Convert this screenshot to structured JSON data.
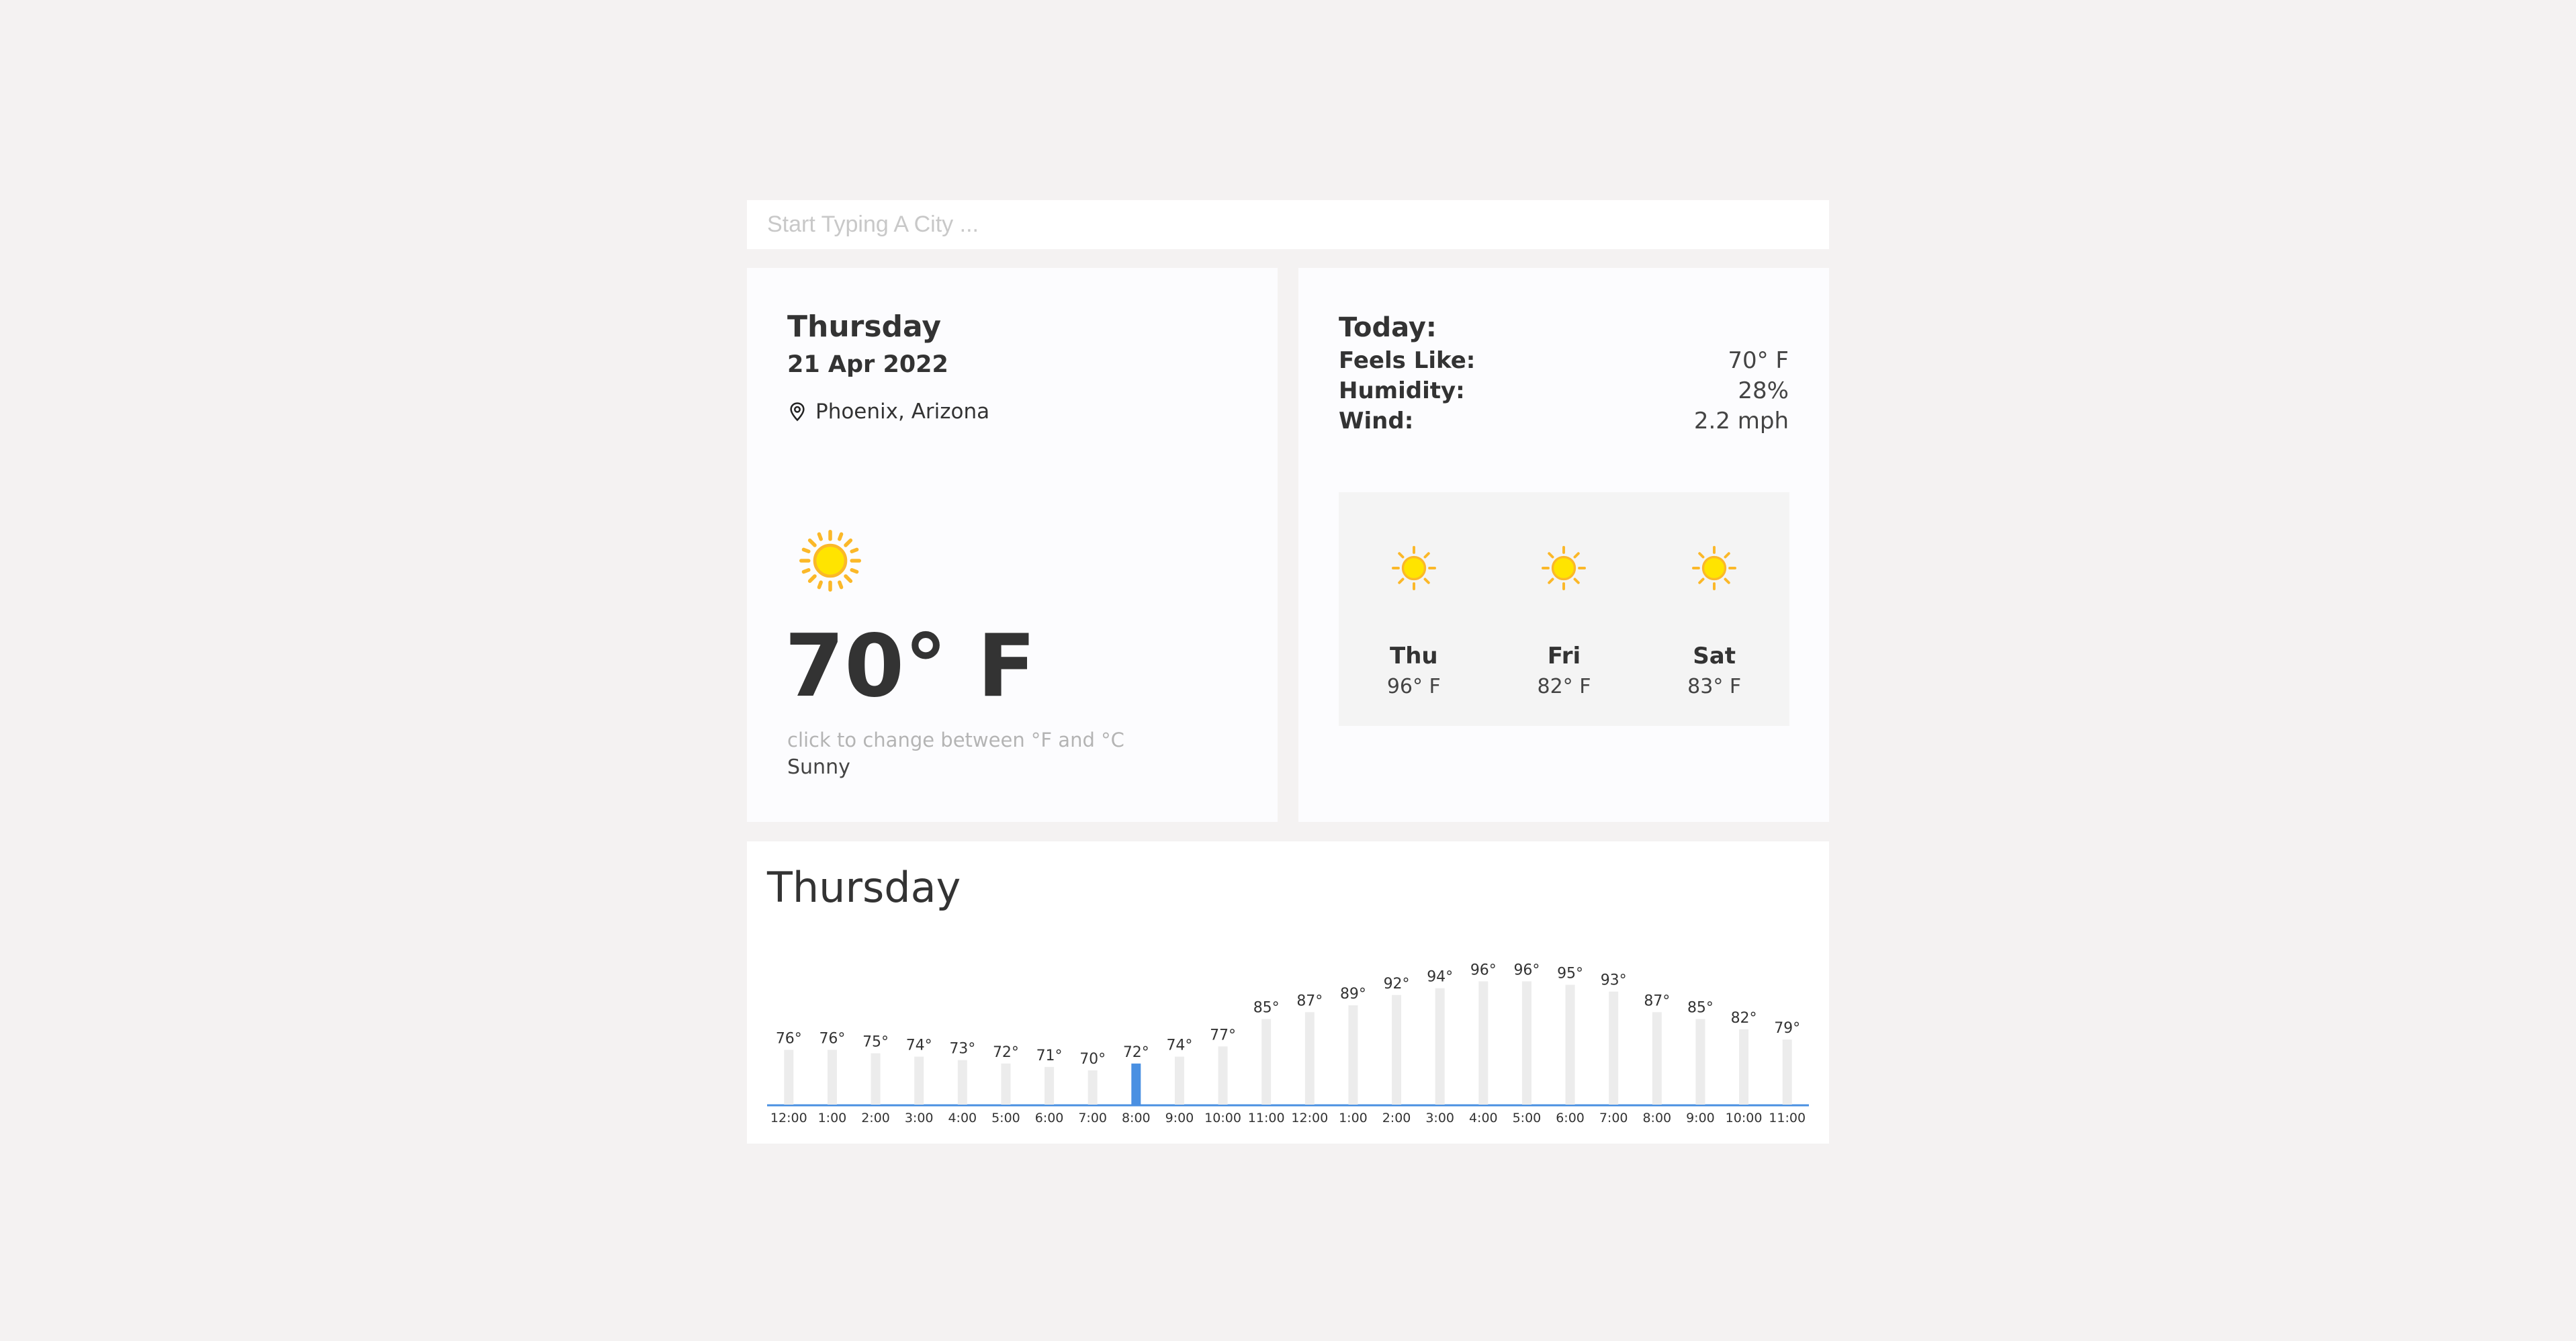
{
  "search": {
    "placeholder": "Start Typing A City ..."
  },
  "current": {
    "day": "Thursday",
    "date": "21 Apr 2022",
    "location": "Phoenix, Arizona",
    "location_icon": "map-pin-icon",
    "weather_icon": "sun-icon",
    "temperature": "70° F",
    "unit_hint": "click to change between °F and °C",
    "condition": "Sunny"
  },
  "today": {
    "title": "Today:",
    "feels_like_label": "Feels Like:",
    "feels_like_value": "70° F",
    "humidity_label": "Humidity:",
    "humidity_value": "28%",
    "wind_label": "Wind:",
    "wind_value": "2.2 mph"
  },
  "forecast": [
    {
      "day": "Thu",
      "temp": "96° F",
      "icon": "sun-icon"
    },
    {
      "day": "Fri",
      "temp": "82° F",
      "icon": "sun-icon"
    },
    {
      "day": "Sat",
      "temp": "83° F",
      "icon": "sun-icon"
    }
  ],
  "colors": {
    "sun_fill": "#ffe400",
    "sun_ray": "#fbb829",
    "highlight_bar": "#4a90e2",
    "bar": "#ececec",
    "baseline": "#4a90e2"
  },
  "chart_data": {
    "type": "bar",
    "title": "Thursday",
    "categories": [
      "12:00",
      "1:00",
      "2:00",
      "3:00",
      "4:00",
      "5:00",
      "6:00",
      "7:00",
      "8:00",
      "9:00",
      "10:00",
      "11:00",
      "12:00",
      "1:00",
      "2:00",
      "3:00",
      "4:00",
      "5:00",
      "6:00",
      "7:00",
      "8:00",
      "9:00",
      "10:00",
      "11:00"
    ],
    "values": [
      76,
      76,
      75,
      74,
      73,
      72,
      71,
      70,
      72,
      74,
      77,
      85,
      87,
      89,
      92,
      94,
      96,
      96,
      95,
      93,
      87,
      85,
      82,
      79
    ],
    "value_labels": [
      "76°",
      "76°",
      "75°",
      "74°",
      "73°",
      "72°",
      "71°",
      "70°",
      "72°",
      "74°",
      "77°",
      "85°",
      "87°",
      "89°",
      "92°",
      "94°",
      "96°",
      "96°",
      "95°",
      "93°",
      "87°",
      "85°",
      "82°",
      "79°"
    ],
    "highlighted_index": 8,
    "xlabel": "",
    "ylabel": "",
    "grid": false
  }
}
